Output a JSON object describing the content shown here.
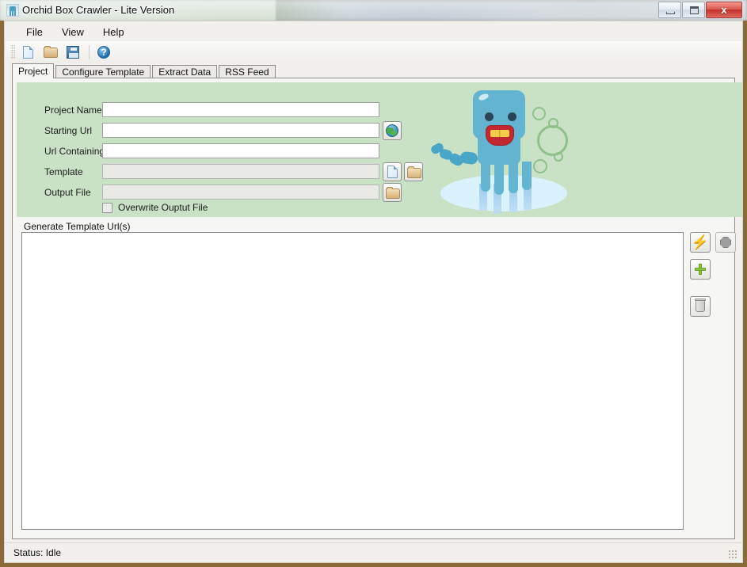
{
  "window": {
    "title": "Orchid Box Crawler - Lite Version",
    "app_icon": "orchid-octopus-icon",
    "minimize_label": "",
    "maximize_label": "",
    "close_label": "x"
  },
  "menu": {
    "items": [
      {
        "label": "File"
      },
      {
        "label": "View"
      },
      {
        "label": "Help"
      }
    ]
  },
  "toolbar": {
    "buttons": [
      {
        "name": "new-document-button",
        "icon": "new-page-icon"
      },
      {
        "name": "open-project-button",
        "icon": "open-folder-icon"
      },
      {
        "name": "save-project-button",
        "icon": "save-floppy-icon"
      },
      {
        "name": "help-button",
        "icon": "help-question-icon"
      }
    ]
  },
  "tabs": [
    {
      "label": "Project",
      "active": true
    },
    {
      "label": "Configure Template",
      "active": false
    },
    {
      "label": "Extract Data",
      "active": false
    },
    {
      "label": "RSS Feed",
      "active": false
    }
  ],
  "project_form": {
    "panel_color": "#c9e2c6",
    "fields": [
      {
        "label": "Project Name",
        "value": "",
        "placeholder": "",
        "disabled": false
      },
      {
        "label": "Starting Url",
        "value": "",
        "placeholder": "",
        "disabled": false
      },
      {
        "label": "Url Containing",
        "value": "",
        "placeholder": "",
        "disabled": false
      },
      {
        "label": "Template",
        "value": "",
        "placeholder": "",
        "disabled": true
      },
      {
        "label": "Output File",
        "value": "",
        "placeholder": "",
        "disabled": true
      }
    ],
    "browse_url_button": "globe-icon",
    "template_new_button": "new-page-icon",
    "template_browse_button": "open-folder-icon",
    "output_browse_button": "open-folder-icon",
    "overwrite_checkbox": {
      "label": "Overwrite Ouptut File",
      "checked": false
    }
  },
  "mascot": {
    "name": "octopus-mascot",
    "body_color": "#63b4d1",
    "bubble_color": "#8fc08a",
    "water_color": "#d9f2fb"
  },
  "generate_group": {
    "title": "Generate Template Url(s)",
    "listbox_items": [],
    "buttons": [
      {
        "name": "generate-urls-button",
        "icon": "lightning-bolt-icon",
        "enabled": true
      },
      {
        "name": "stop-button",
        "icon": "stop-octagon-icon",
        "enabled": false
      },
      {
        "name": "add-url-button",
        "icon": "green-plus-icon",
        "enabled": true
      },
      {
        "name": "delete-url-button",
        "icon": "trash-icon",
        "enabled": true
      }
    ]
  },
  "statusbar": {
    "text": "Status:  Idle"
  }
}
